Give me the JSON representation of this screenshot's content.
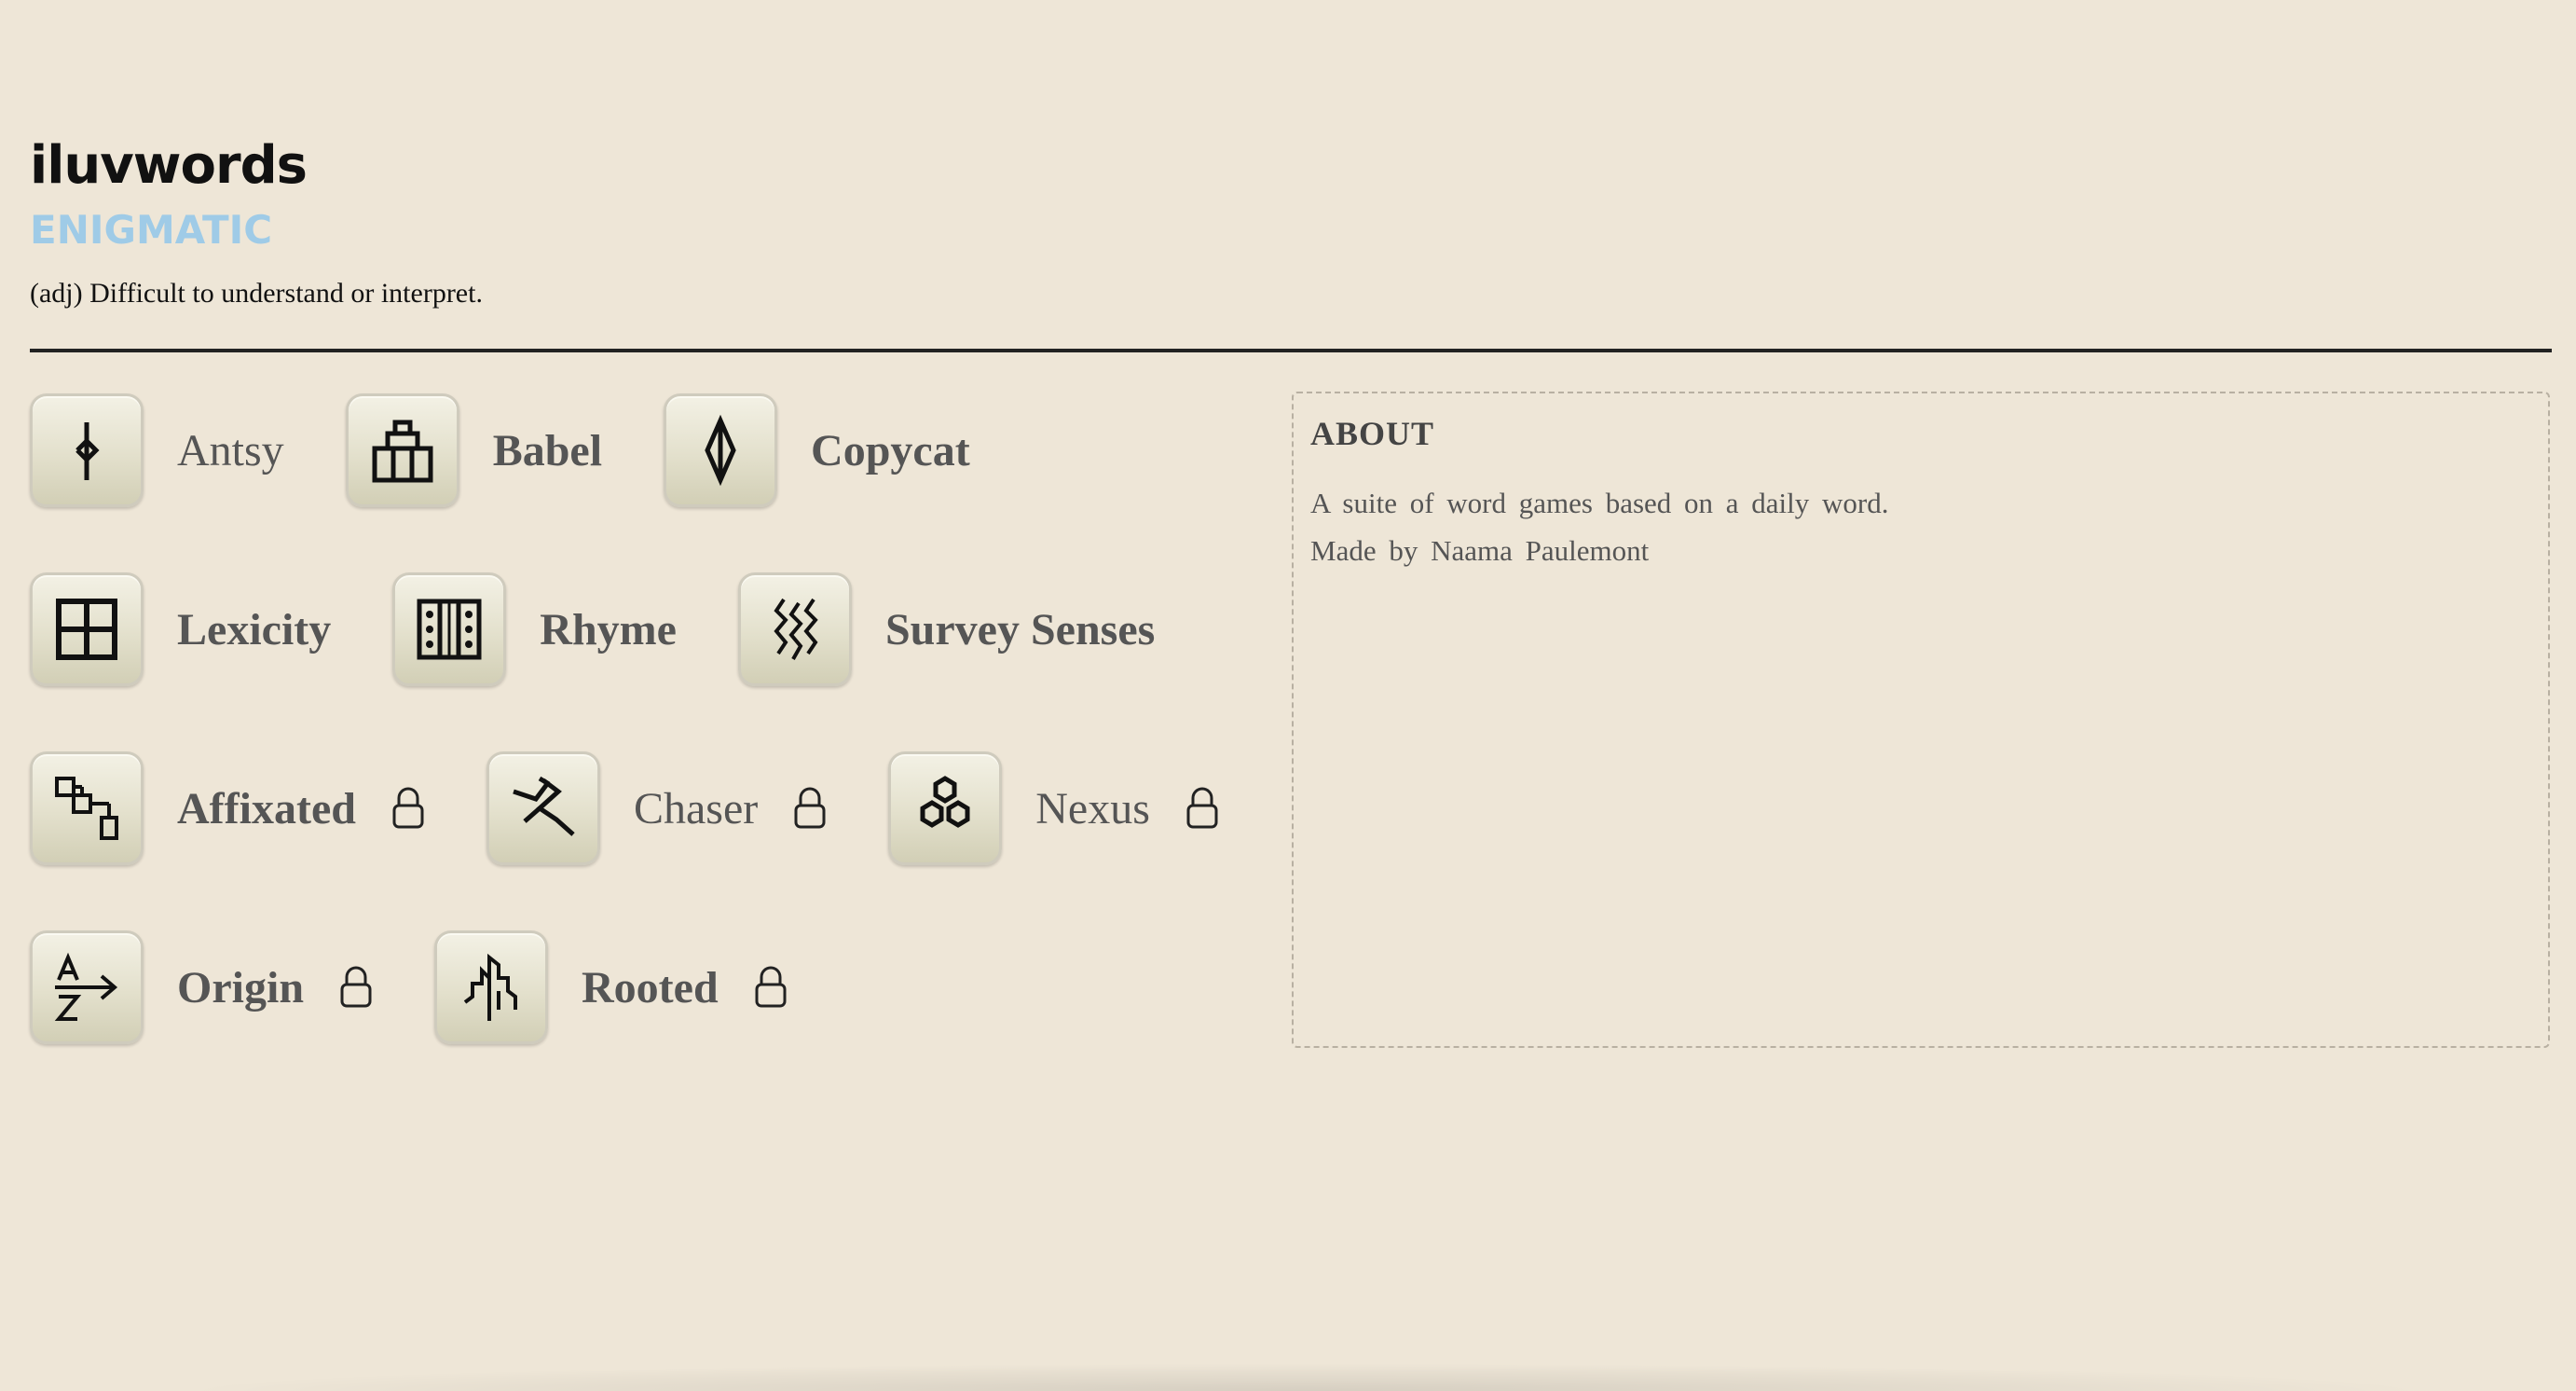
{
  "header": {
    "app_title": "iluvwords",
    "word": "ENIGMATIC",
    "definition": "(adj) Difficult to understand or interpret."
  },
  "games": {
    "row1": [
      {
        "name": "Antsy",
        "icon": "antsy-icon",
        "locked": false
      },
      {
        "name": "Babel",
        "icon": "babel-icon",
        "locked": false
      },
      {
        "name": "Copycat",
        "icon": "copycat-icon",
        "locked": false
      }
    ],
    "row2": [
      {
        "name": "Lexicity",
        "icon": "lexicity-icon",
        "locked": false
      },
      {
        "name": "Rhyme",
        "icon": "rhyme-icon",
        "locked": false
      },
      {
        "name": "Survey Senses",
        "icon": "survey-senses-icon",
        "locked": false
      }
    ],
    "row3": [
      {
        "name": "Affixated",
        "icon": "affixated-icon",
        "locked": true
      },
      {
        "name": "Chaser",
        "icon": "chaser-icon",
        "locked": true
      },
      {
        "name": "Nexus",
        "icon": "nexus-icon",
        "locked": true
      }
    ],
    "row4": [
      {
        "name": "Origin",
        "icon": "origin-icon",
        "locked": true
      },
      {
        "name": "Rooted",
        "icon": "rooted-icon",
        "locked": true
      }
    ]
  },
  "about": {
    "title": "ABOUT",
    "line1": "A suite of word games based on a daily word.",
    "line2": "Made by Naama Paulemont"
  },
  "colors": {
    "background": "#eee6d7",
    "accent_word": "#9fcbe7",
    "game_name": "#555555"
  }
}
